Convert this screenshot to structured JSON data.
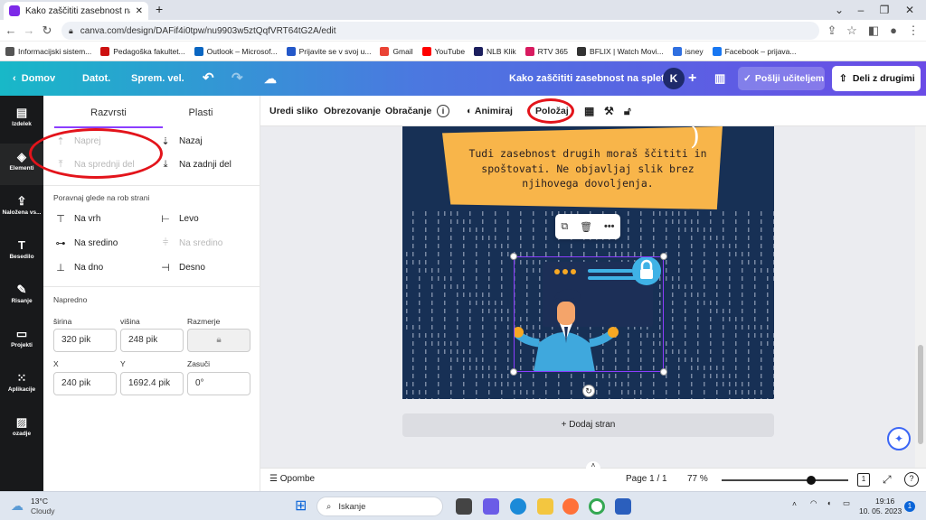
{
  "browser": {
    "tab_title": "Kako zaščititi zasebnost na splet",
    "new_tab": "+",
    "url": "canva.com/design/DAFif4i0tpw/nu9903w5ztQqfVRT64tG2A/edit",
    "bookmarks": [
      "Informacijski sistem...",
      "Pedagoška fakultet...",
      "Outlook – Microsof...",
      "Prijavite se v svoj u...",
      "Gmail",
      "YouTube",
      "NLB Klik",
      "RTV 365",
      "BFLIX | Watch Movi...",
      "isney",
      "Facebook – prijava..."
    ],
    "bookmark_colors": [
      "#555555",
      "#cc1111",
      "#0a66c2",
      "#2458c9",
      "#ea4335",
      "#ff0000",
      "#1c1f5e",
      "#d81b60",
      "#333333",
      "#2f6fe0",
      "#1877f2"
    ]
  },
  "header": {
    "home": "Domov",
    "file": "Datot.",
    "resize": "Sprem. vel.",
    "doc_title": "Kako zaščititi zasebnost na spletu",
    "avatar": "K",
    "send": "Pošlji učiteljem",
    "share": "Deli z drugimi"
  },
  "rail": [
    {
      "label": "Izdelek",
      "icon": "layout-icon"
    },
    {
      "label": "Elementi",
      "icon": "elements-icon"
    },
    {
      "label": "Naložena vs...",
      "icon": "upload-icon"
    },
    {
      "label": "Besedilo",
      "icon": "text-icon"
    },
    {
      "label": "Risanje",
      "icon": "draw-icon"
    },
    {
      "label": "Projekti",
      "icon": "folder-icon"
    },
    {
      "label": "Aplikacije",
      "icon": "apps-icon"
    },
    {
      "label": "ozadje",
      "icon": "background-icon"
    }
  ],
  "panel": {
    "tab_arrange": "Razvrsti",
    "tab_layers": "Plasti",
    "forward": "Naprej",
    "backward": "Nazaj",
    "to_front": "Na sprednji del",
    "to_back": "Na zadnji del",
    "align_title": "Poravnaj glede na rob strani",
    "align_top": "Na vrh",
    "align_left": "Levo",
    "align_middle": "Na sredino",
    "align_center": "Na sredino",
    "align_bottom": "Na dno",
    "align_right": "Desno",
    "advanced_title": "Napredno",
    "width_label": "širina",
    "height_label": "višina",
    "ratio_label": "Razmerje",
    "width_value": "320 pik",
    "height_value": "248 pik",
    "x_label": "X",
    "y_label": "Y",
    "rotate_label": "Zasuči",
    "x_value": "240 pik",
    "y_value": "1692.4 pik",
    "rotate_value": "0°"
  },
  "toolbar": {
    "edit": "Uredi sliko",
    "crop": "Obrezovanje",
    "flip": "Obračanje",
    "info": "i",
    "animate": "Animiraj",
    "position": "Položaj"
  },
  "canvas": {
    "quote": "Tudi zasebnost drugih moraš ščititi in spoštovati. Ne objavljaj slik brez njihovega dovoljenja.",
    "add_page": "+ Dodaj stran"
  },
  "footer": {
    "notes": "Opombe",
    "page": "Page 1 / 1",
    "zoom": "77 %",
    "zoom_level": 0.77,
    "pages_badge": "1",
    "help": "?"
  },
  "taskbar": {
    "temp": "13°C",
    "weather": "Cloudy",
    "search": "Iskanje",
    "time": "19:16",
    "date": "10. 05. 2023",
    "badge": "1"
  },
  "colors": {
    "accent": "#8b3dff",
    "highlight_ring": "#e3141b",
    "canvas_bg": "#173055",
    "paper": "#f8b54a"
  }
}
